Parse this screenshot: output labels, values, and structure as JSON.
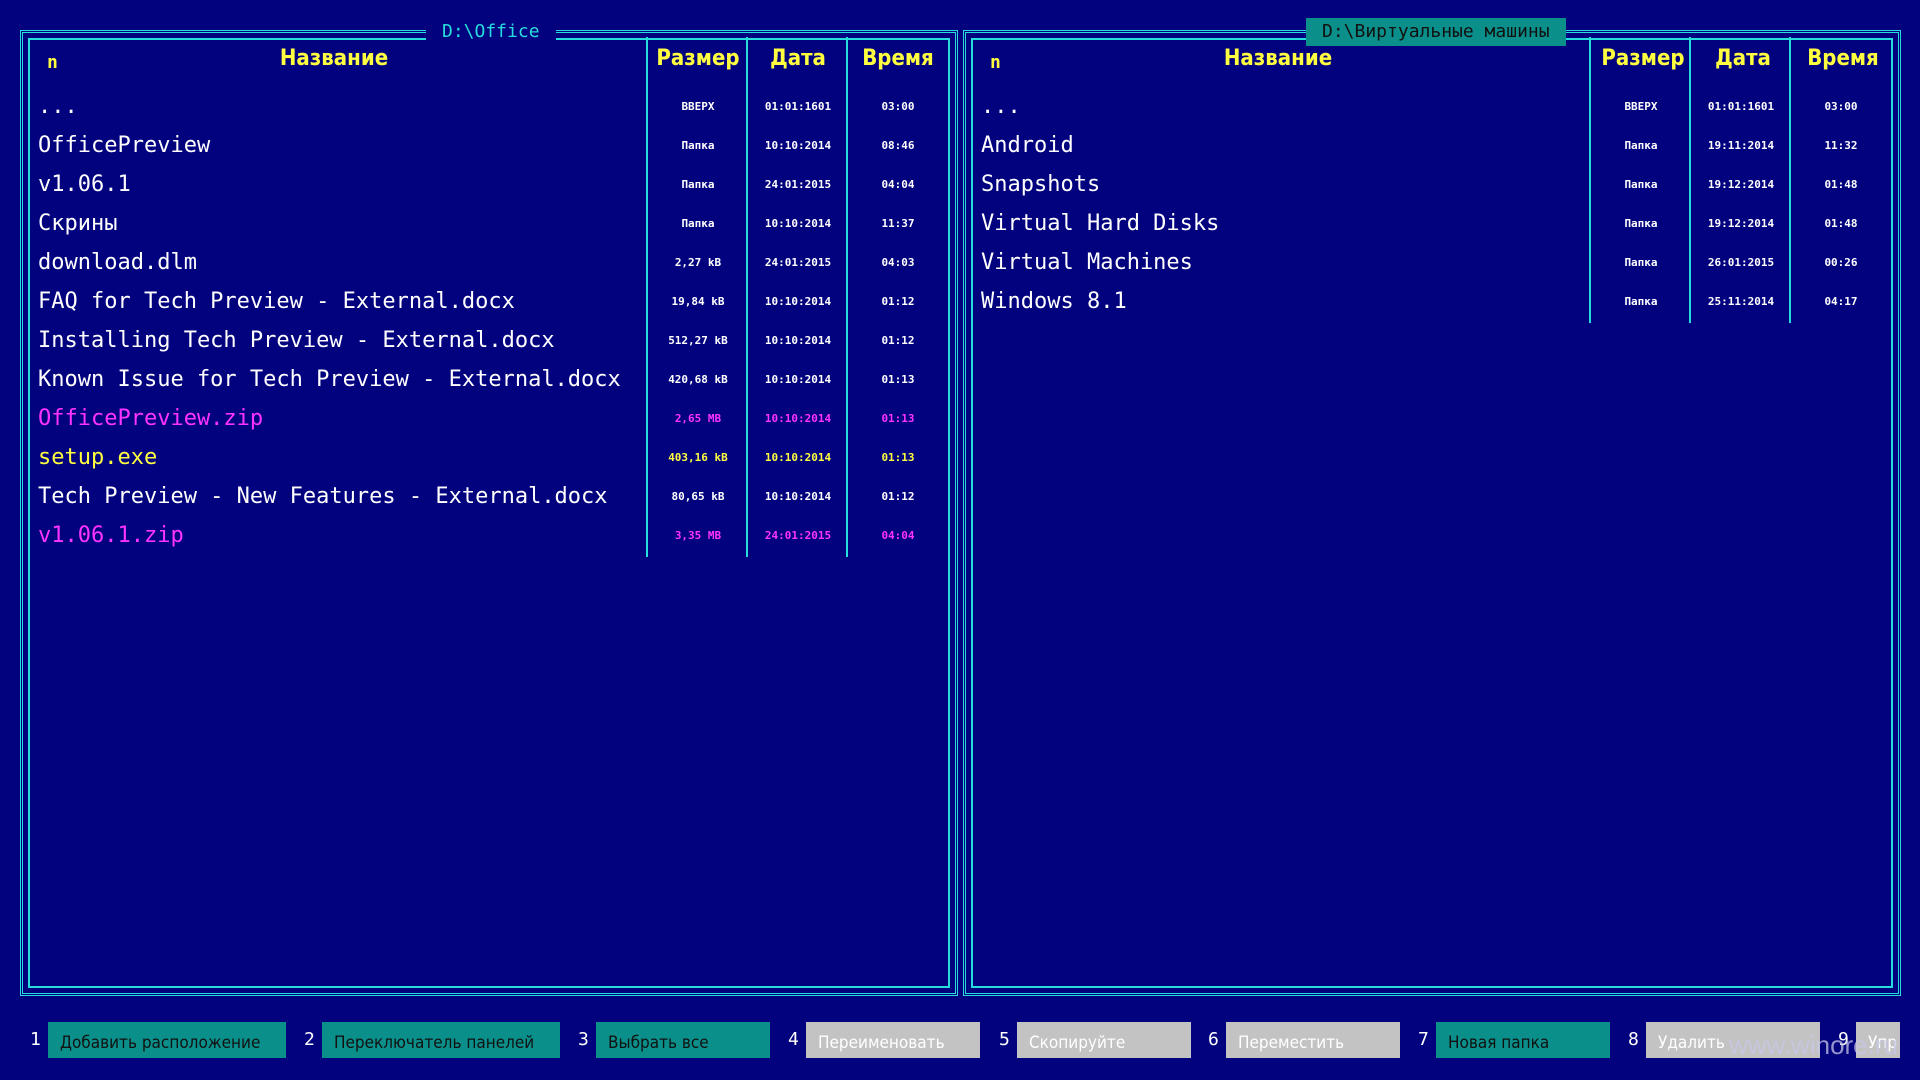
{
  "left_panel": {
    "path": "D:\\Office",
    "headers": {
      "sort": "n",
      "name": "Название",
      "size": "Размер",
      "date": "Дата",
      "time": "Время"
    },
    "rows": [
      {
        "name": "...",
        "size": "ВВЕРХ",
        "date": "01:01:1601",
        "time": "03:00",
        "color": "white"
      },
      {
        "name": "OfficePreview",
        "size": "Папка",
        "date": "10:10:2014",
        "time": "08:46",
        "color": "white"
      },
      {
        "name": "v1.06.1",
        "size": "Папка",
        "date": "24:01:2015",
        "time": "04:04",
        "color": "white"
      },
      {
        "name": "Скрины",
        "size": "Папка",
        "date": "10:10:2014",
        "time": "11:37",
        "color": "white"
      },
      {
        "name": "download.dlm",
        "size": "2,27 kB",
        "date": "24:01:2015",
        "time": "04:03",
        "color": "white"
      },
      {
        "name": "FAQ for Tech Preview - External.docx",
        "size": "19,84 kB",
        "date": "10:10:2014",
        "time": "01:12",
        "color": "white"
      },
      {
        "name": "Installing Tech Preview - External.docx",
        "size": "512,27 kB",
        "date": "10:10:2014",
        "time": "01:12",
        "color": "white"
      },
      {
        "name": "Known Issue for Tech Preview - External.docx",
        "size": "420,68 kB",
        "date": "10:10:2014",
        "time": "01:13",
        "color": "white"
      },
      {
        "name": "OfficePreview.zip",
        "size": "2,65 MB",
        "date": "10:10:2014",
        "time": "01:13",
        "color": "magenta"
      },
      {
        "name": "setup.exe",
        "size": "403,16 kB",
        "date": "10:10:2014",
        "time": "01:13",
        "color": "yellow"
      },
      {
        "name": "Tech Preview - New Features - External.docx",
        "size": "80,65 kB",
        "date": "10:10:2014",
        "time": "01:12",
        "color": "white"
      },
      {
        "name": "v1.06.1.zip",
        "size": "3,35 MB",
        "date": "24:01:2015",
        "time": "04:04",
        "color": "magenta"
      }
    ]
  },
  "right_panel": {
    "path": "D:\\Виртуальные машины",
    "headers": {
      "sort": "n",
      "name": "Название",
      "size": "Размер",
      "date": "Дата",
      "time": "Время"
    },
    "rows": [
      {
        "name": "...",
        "size": "ВВЕРХ",
        "date": "01:01:1601",
        "time": "03:00",
        "color": "white"
      },
      {
        "name": "Android",
        "size": "Папка",
        "date": "19:11:2014",
        "time": "11:32",
        "color": "white"
      },
      {
        "name": "Snapshots",
        "size": "Папка",
        "date": "19:12:2014",
        "time": "01:48",
        "color": "white"
      },
      {
        "name": "Virtual Hard Disks",
        "size": "Папка",
        "date": "19:12:2014",
        "time": "01:48",
        "color": "white"
      },
      {
        "name": "Virtual Machines",
        "size": "Папка",
        "date": "26:01:2015",
        "time": "00:26",
        "color": "white"
      },
      {
        "name": "Windows 8.1",
        "size": "Папка",
        "date": "25:11:2014",
        "time": "04:17",
        "color": "white"
      }
    ]
  },
  "function_keys": [
    {
      "num": "1",
      "label": "Добавить расположение",
      "style": "teal"
    },
    {
      "num": "2",
      "label": "Переключатель панелей",
      "style": "teal"
    },
    {
      "num": "3",
      "label": "Выбрать все",
      "style": "teal"
    },
    {
      "num": "4",
      "label": "Переименовать",
      "style": "gray"
    },
    {
      "num": "5",
      "label": "Скопируйте",
      "style": "gray"
    },
    {
      "num": "6",
      "label": "Переместить",
      "style": "gray"
    },
    {
      "num": "7",
      "label": "Новая папка",
      "style": "teal"
    },
    {
      "num": "8",
      "label": "Удалить",
      "style": "gray"
    },
    {
      "num": "9",
      "label": "Упр",
      "style": "gray"
    }
  ],
  "watermark": "www.winore.ru",
  "colors": {
    "background": "#02027e",
    "border": "#27dcdc",
    "header": "#ffff40",
    "magenta": "#ff33ff",
    "teal": "#0b8f8a",
    "gray": "#c3c3c3"
  }
}
